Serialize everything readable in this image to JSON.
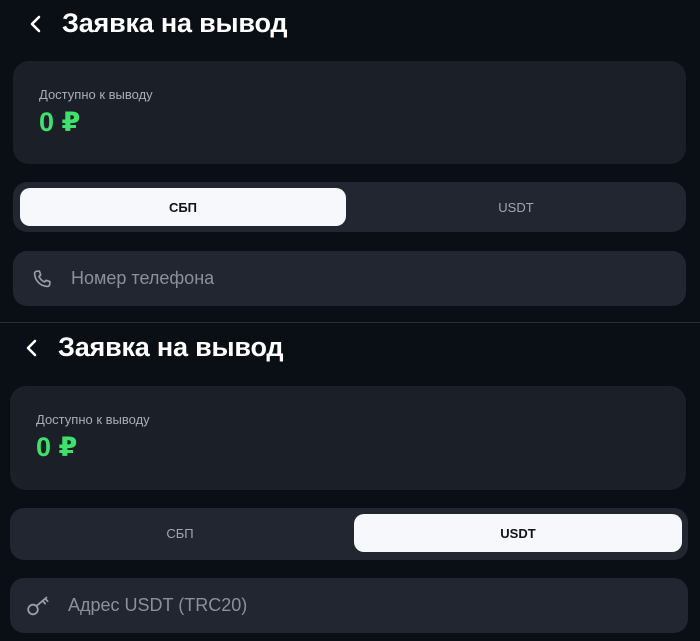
{
  "screens": [
    {
      "header": {
        "title": "Заявка на вывод"
      },
      "balance": {
        "label": "Доступно к выводу",
        "value": "0 ₽"
      },
      "tabs": [
        {
          "label": "СБП",
          "active": true
        },
        {
          "label": "USDT",
          "active": false
        }
      ],
      "field": {
        "placeholder": "Номер телефона",
        "value": "",
        "icon": "phone-icon"
      }
    },
    {
      "header": {
        "title": "Заявка на вывод"
      },
      "balance": {
        "label": "Доступно к выводу",
        "value": "0 ₽"
      },
      "tabs": [
        {
          "label": "СБП",
          "active": false
        },
        {
          "label": "USDT",
          "active": true
        }
      ],
      "field": {
        "placeholder": "Адрес USDT (TRC20)",
        "value": "",
        "icon": "key-icon"
      }
    }
  ],
  "colors": {
    "background": "#0a0e15",
    "card": "#1b1f28",
    "control": "#222630",
    "accent_green": "#3fe06c",
    "active_tab": "#f7f8fb"
  }
}
